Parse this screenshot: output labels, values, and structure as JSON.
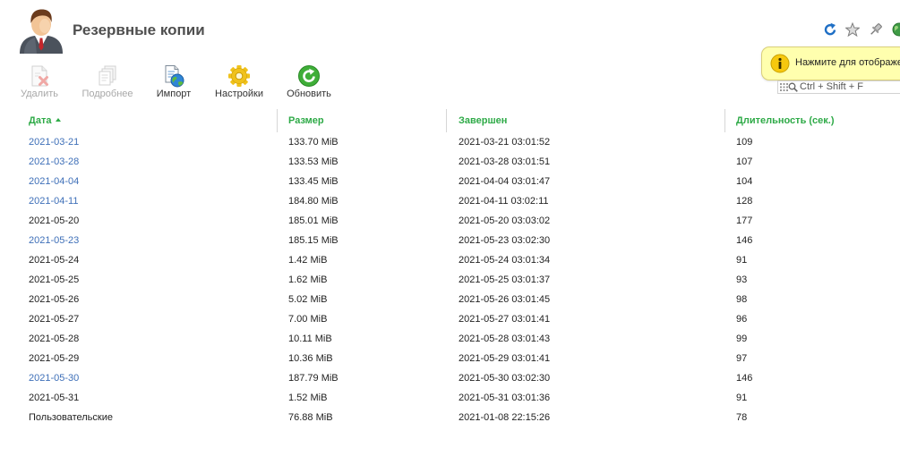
{
  "page": {
    "title": "Резервные копии"
  },
  "header_icons": {
    "refresh": "refresh-icon",
    "favorite": "star-icon",
    "pin": "pin-icon",
    "globe": "globe-icon"
  },
  "toolbar": {
    "delete": {
      "label": "Удалить",
      "icon": "delete-icon",
      "disabled": true
    },
    "details": {
      "label": "Подробнее",
      "icon": "details-icon",
      "disabled": true
    },
    "import": {
      "label": "Импорт",
      "icon": "import-icon",
      "disabled": false
    },
    "settings": {
      "label": "Настройки",
      "icon": "gear-icon",
      "disabled": false
    },
    "refresh": {
      "label": "Обновить",
      "icon": "refresh-icon",
      "disabled": false
    }
  },
  "notification": {
    "text": "Нажмите для отображе",
    "icon": "info-icon"
  },
  "search": {
    "placeholder": "Ctrl + Shift + F",
    "value": ""
  },
  "table": {
    "columns": [
      "Дата",
      "Размер",
      "Завершен",
      "Длительность (сек.)"
    ],
    "sort": {
      "column_index": 0,
      "ascending": true
    },
    "rows": [
      {
        "date": "2021-03-21",
        "size": "133.70 MiB",
        "finished": "2021-03-21 03:01:52",
        "duration": 109,
        "link": true
      },
      {
        "date": "2021-03-28",
        "size": "133.53 MiB",
        "finished": "2021-03-28 03:01:51",
        "duration": 107,
        "link": true
      },
      {
        "date": "2021-04-04",
        "size": "133.45 MiB",
        "finished": "2021-04-04 03:01:47",
        "duration": 104,
        "link": true
      },
      {
        "date": "2021-04-11",
        "size": "184.80 MiB",
        "finished": "2021-04-11 03:02:11",
        "duration": 128,
        "link": true
      },
      {
        "date": "2021-05-20",
        "size": "185.01 MiB",
        "finished": "2021-05-20 03:03:02",
        "duration": 177,
        "link": false
      },
      {
        "date": "2021-05-23",
        "size": "185.15 MiB",
        "finished": "2021-05-23 03:02:30",
        "duration": 146,
        "link": true
      },
      {
        "date": "2021-05-24",
        "size": "1.42 MiB",
        "finished": "2021-05-24 03:01:34",
        "duration": 91,
        "link": false
      },
      {
        "date": "2021-05-25",
        "size": "1.62 MiB",
        "finished": "2021-05-25 03:01:37",
        "duration": 93,
        "link": false
      },
      {
        "date": "2021-05-26",
        "size": "5.02 MiB",
        "finished": "2021-05-26 03:01:45",
        "duration": 98,
        "link": false
      },
      {
        "date": "2021-05-27",
        "size": "7.00 MiB",
        "finished": "2021-05-27 03:01:41",
        "duration": 96,
        "link": false
      },
      {
        "date": "2021-05-28",
        "size": "10.11 MiB",
        "finished": "2021-05-28 03:01:43",
        "duration": 99,
        "link": false
      },
      {
        "date": "2021-05-29",
        "size": "10.36 MiB",
        "finished": "2021-05-29 03:01:41",
        "duration": 97,
        "link": false
      },
      {
        "date": "2021-05-30",
        "size": "187.79 MiB",
        "finished": "2021-05-30 03:02:30",
        "duration": 146,
        "link": true
      },
      {
        "date": "2021-05-31",
        "size": "1.52 MiB",
        "finished": "2021-05-31 03:01:36",
        "duration": 91,
        "link": false
      },
      {
        "date": "Пользовательские",
        "size": "76.88 MiB",
        "finished": "2021-01-08 22:15:26",
        "duration": 78,
        "link": false
      }
    ]
  },
  "colors": {
    "header_text": "#2eaa47",
    "link": "#3e6fb8",
    "text": "#222222",
    "disabled_text": "#a8a8a8",
    "notification_bg": "#ffffae",
    "notification_border": "#d9cf7a"
  }
}
